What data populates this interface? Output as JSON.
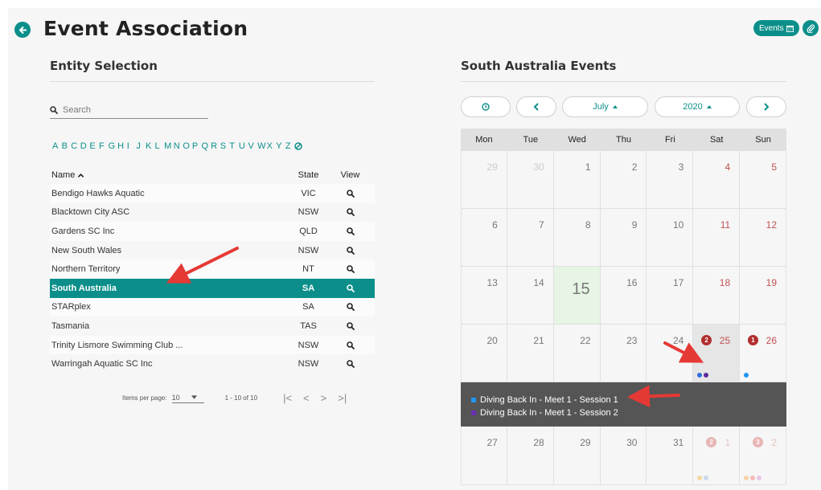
{
  "header": {
    "title": "Event Association",
    "events_button": "Events",
    "accent": "#0c8f8a"
  },
  "entity_selection": {
    "title": "Entity Selection",
    "search_placeholder": "Search",
    "alphabet": [
      "A",
      "B",
      "C",
      "D",
      "E",
      "F",
      "G",
      "H",
      "I",
      "J",
      "K",
      "L",
      "M",
      "N",
      "O",
      "P",
      "Q",
      "R",
      "S",
      "T",
      "U",
      "V",
      "W",
      "X",
      "Y",
      "Z"
    ],
    "columns": {
      "name": "Name",
      "state": "State",
      "view": "View"
    },
    "sort_icon": "chevron-up-icon",
    "rows": [
      {
        "name": "Bendigo Hawks Aquatic",
        "state": "VIC"
      },
      {
        "name": "Blacktown City ASC",
        "state": "NSW"
      },
      {
        "name": "Gardens SC Inc",
        "state": "QLD"
      },
      {
        "name": "New South Wales",
        "state": "NSW"
      },
      {
        "name": "Northern Territory",
        "state": "NT"
      },
      {
        "name": "South Australia",
        "state": "SA",
        "selected": true
      },
      {
        "name": "STARplex",
        "state": "SA"
      },
      {
        "name": "Tasmania",
        "state": "TAS"
      },
      {
        "name": "Trinity Lismore Swimming Club ...",
        "state": "NSW"
      },
      {
        "name": "Warringah Aquatic SC Inc",
        "state": "NSW"
      }
    ],
    "pager": {
      "items_per_page_label": "Items per page:",
      "items_per_page": "10",
      "range": "1 - 10 of 10"
    }
  },
  "calendar": {
    "title": "South Australia Events",
    "month": "July",
    "year": "2020",
    "weekdays": [
      "Mon",
      "Tue",
      "Wed",
      "Thu",
      "Fri",
      "Sat",
      "Sun"
    ],
    "weeks": [
      [
        {
          "d": "29",
          "other": true
        },
        {
          "d": "30",
          "other": true
        },
        {
          "d": "1"
        },
        {
          "d": "2"
        },
        {
          "d": "3"
        },
        {
          "d": "4",
          "weekend": true
        },
        {
          "d": "5",
          "weekend": true
        }
      ],
      [
        {
          "d": "6"
        },
        {
          "d": "7"
        },
        {
          "d": "8"
        },
        {
          "d": "9"
        },
        {
          "d": "10"
        },
        {
          "d": "11",
          "weekend": true
        },
        {
          "d": "12",
          "weekend": true
        }
      ],
      [
        {
          "d": "13"
        },
        {
          "d": "14"
        },
        {
          "d": "15",
          "today": true
        },
        {
          "d": "16"
        },
        {
          "d": "17"
        },
        {
          "d": "18",
          "weekend": true
        },
        {
          "d": "19",
          "weekend": true
        }
      ],
      [
        {
          "d": "20"
        },
        {
          "d": "21"
        },
        {
          "d": "22"
        },
        {
          "d": "23"
        },
        {
          "d": "24"
        },
        {
          "d": "25",
          "weekend": true,
          "badge": "2",
          "highlight": true,
          "dots": [
            "#2f6fe0",
            "#5b2a9b"
          ]
        },
        {
          "d": "26",
          "weekend": true,
          "badge": "1",
          "dots": [
            "#2196f3"
          ]
        }
      ],
      [
        {
          "d": "27"
        },
        {
          "d": "28"
        },
        {
          "d": "29"
        },
        {
          "d": "30"
        },
        {
          "d": "31"
        },
        {
          "d": "1",
          "weekend": true,
          "other": true,
          "badge": "2",
          "dots": [
            "#f3d9a0",
            "#c9d9ee"
          ]
        },
        {
          "d": "2",
          "weekend": true,
          "other": true,
          "badge": "3",
          "dots": [
            "#f6d3a9",
            "#f3b9b9",
            "#e6c6e6"
          ]
        }
      ]
    ],
    "events": [
      {
        "label": "Diving Back In - Meet 1 - Session 1",
        "color": "#2196f3"
      },
      {
        "label": "Diving Back In - Meet 1 - Session 2",
        "color": "#6b2fb3"
      }
    ]
  }
}
